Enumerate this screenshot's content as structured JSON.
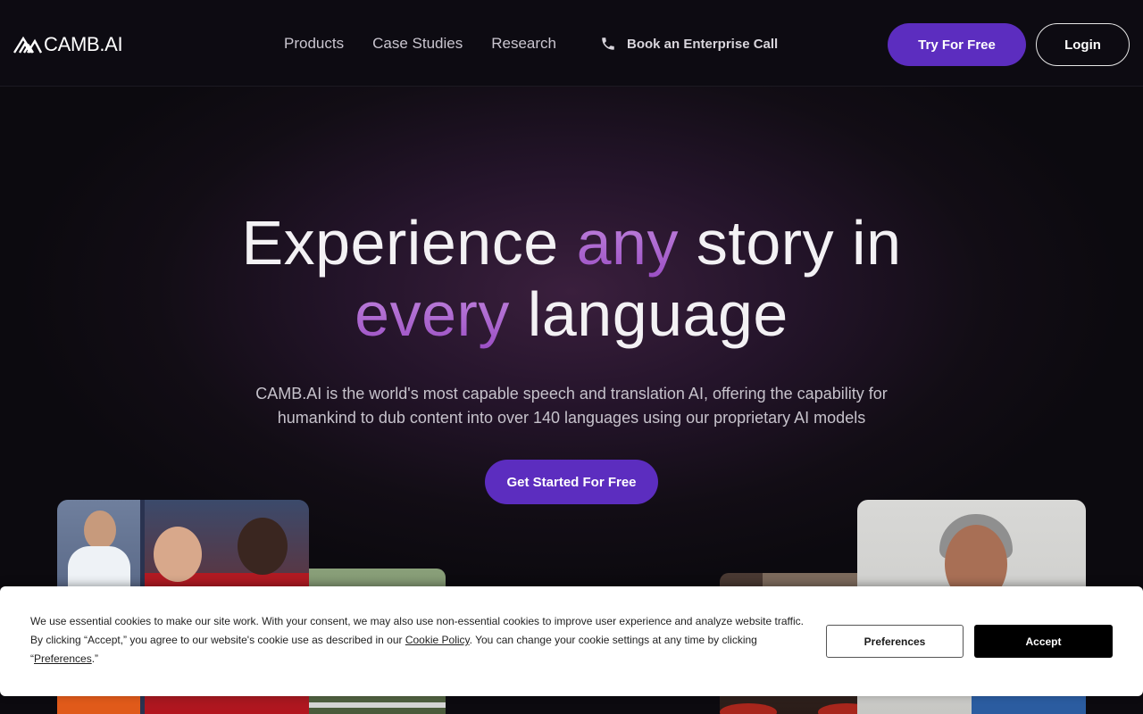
{
  "header": {
    "logo_text": "CAMB.AI",
    "nav": [
      {
        "label": "Products"
      },
      {
        "label": "Case Studies"
      },
      {
        "label": "Research"
      }
    ],
    "enterprise_call": {
      "label": "Book an Enterprise Call",
      "icon": "phone-icon"
    },
    "try_button": "Try For Free",
    "login_button": "Login"
  },
  "hero": {
    "headline": {
      "part1": "Experience ",
      "highlight1": "any",
      "part2": " story in",
      "highlight2": "every",
      "part3": " language"
    },
    "subtext_line1": "CAMB.AI is the world's most capable speech and translation AI, offering the capability for",
    "subtext_line2": "humankind to dub content into over 140 languages using our proprietary AI models",
    "cta": "Get Started For Free"
  },
  "cookie_banner": {
    "text_part1": "We use essential cookies to make our site work. With your consent, we may also use non-essential cookies to improve user experience and analyze website traffic. By clicking “Accept,” you agree to our website's cookie use as described in our ",
    "cookie_policy_link": "Cookie Policy",
    "text_part2": ". You can change your cookie settings at any time by clicking “",
    "preferences_link": "Preferences",
    "text_part3": ".”",
    "preferences_button": "Preferences",
    "accept_button": "Accept"
  },
  "colors": {
    "accent": "#5c2dbf",
    "highlight_gradient_start": "#c58be0",
    "highlight_gradient_end": "#9b4fc4",
    "background": "#0c0a0f"
  }
}
